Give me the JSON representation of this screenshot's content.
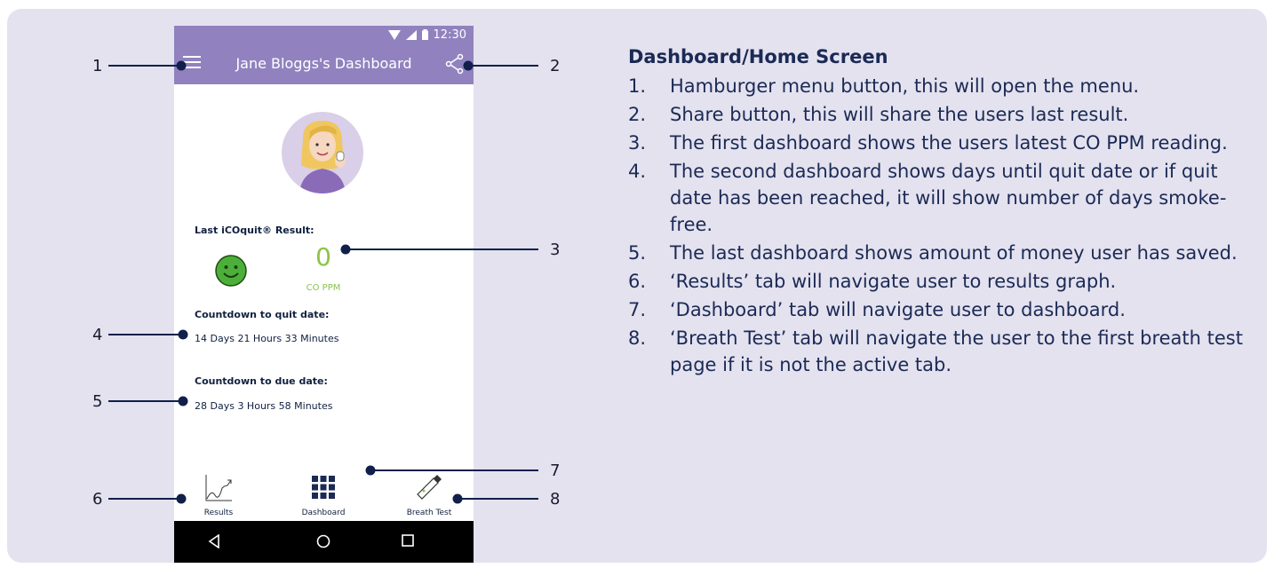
{
  "status_bar": {
    "time": "12:30"
  },
  "app_bar": {
    "title": "Jane Bloggs's Dashboard"
  },
  "dashboard": {
    "last_result_label": "Last iCOquit® Result:",
    "co_value": "0",
    "co_unit": "CO PPM",
    "quit_label": "Countdown to quit date:",
    "quit_value": "14 Days 21 Hours 33 Minutes",
    "due_label": "Countdown to due date:",
    "due_value": "28 Days 3 Hours 58 Minutes"
  },
  "tabs": [
    {
      "label": "Results",
      "icon": "chart-line-icon"
    },
    {
      "label": "Dashboard",
      "icon": "grid-icon"
    },
    {
      "label": "Breath Test",
      "icon": "breath-device-icon"
    }
  ],
  "callout_numbers": [
    "1",
    "2",
    "3",
    "4",
    "5",
    "6",
    "7",
    "8"
  ],
  "colors": {
    "app_bar": "#9182bf",
    "panel_bg": "#e4e2ef",
    "co_green": "#8bc34a",
    "text_navy": "#1b2a55"
  },
  "description": {
    "heading": "Dashboard/Home Screen",
    "items": [
      {
        "n": "1.",
        "text": "Hamburger menu button, this will open the menu."
      },
      {
        "n": "2.",
        "text": "Share button, this will share the users last result."
      },
      {
        "n": "3.",
        "text": "The first dashboard shows the users latest CO PPM reading."
      },
      {
        "n": "4.",
        "text": "The second dashboard shows days until quit date or if quit date has been reached, it will show number of days smoke-free."
      },
      {
        "n": "5.",
        "text": "The last dashboard shows amount of money user has saved."
      },
      {
        "n": "6.",
        "text": "‘Results’ tab will navigate user to results graph."
      },
      {
        "n": "7.",
        "text": "‘Dashboard’ tab will navigate user to dashboard."
      },
      {
        "n": "8.",
        "text": "‘Breath Test’ tab will navigate the user to the first breath test page if it is not the active tab."
      }
    ]
  }
}
